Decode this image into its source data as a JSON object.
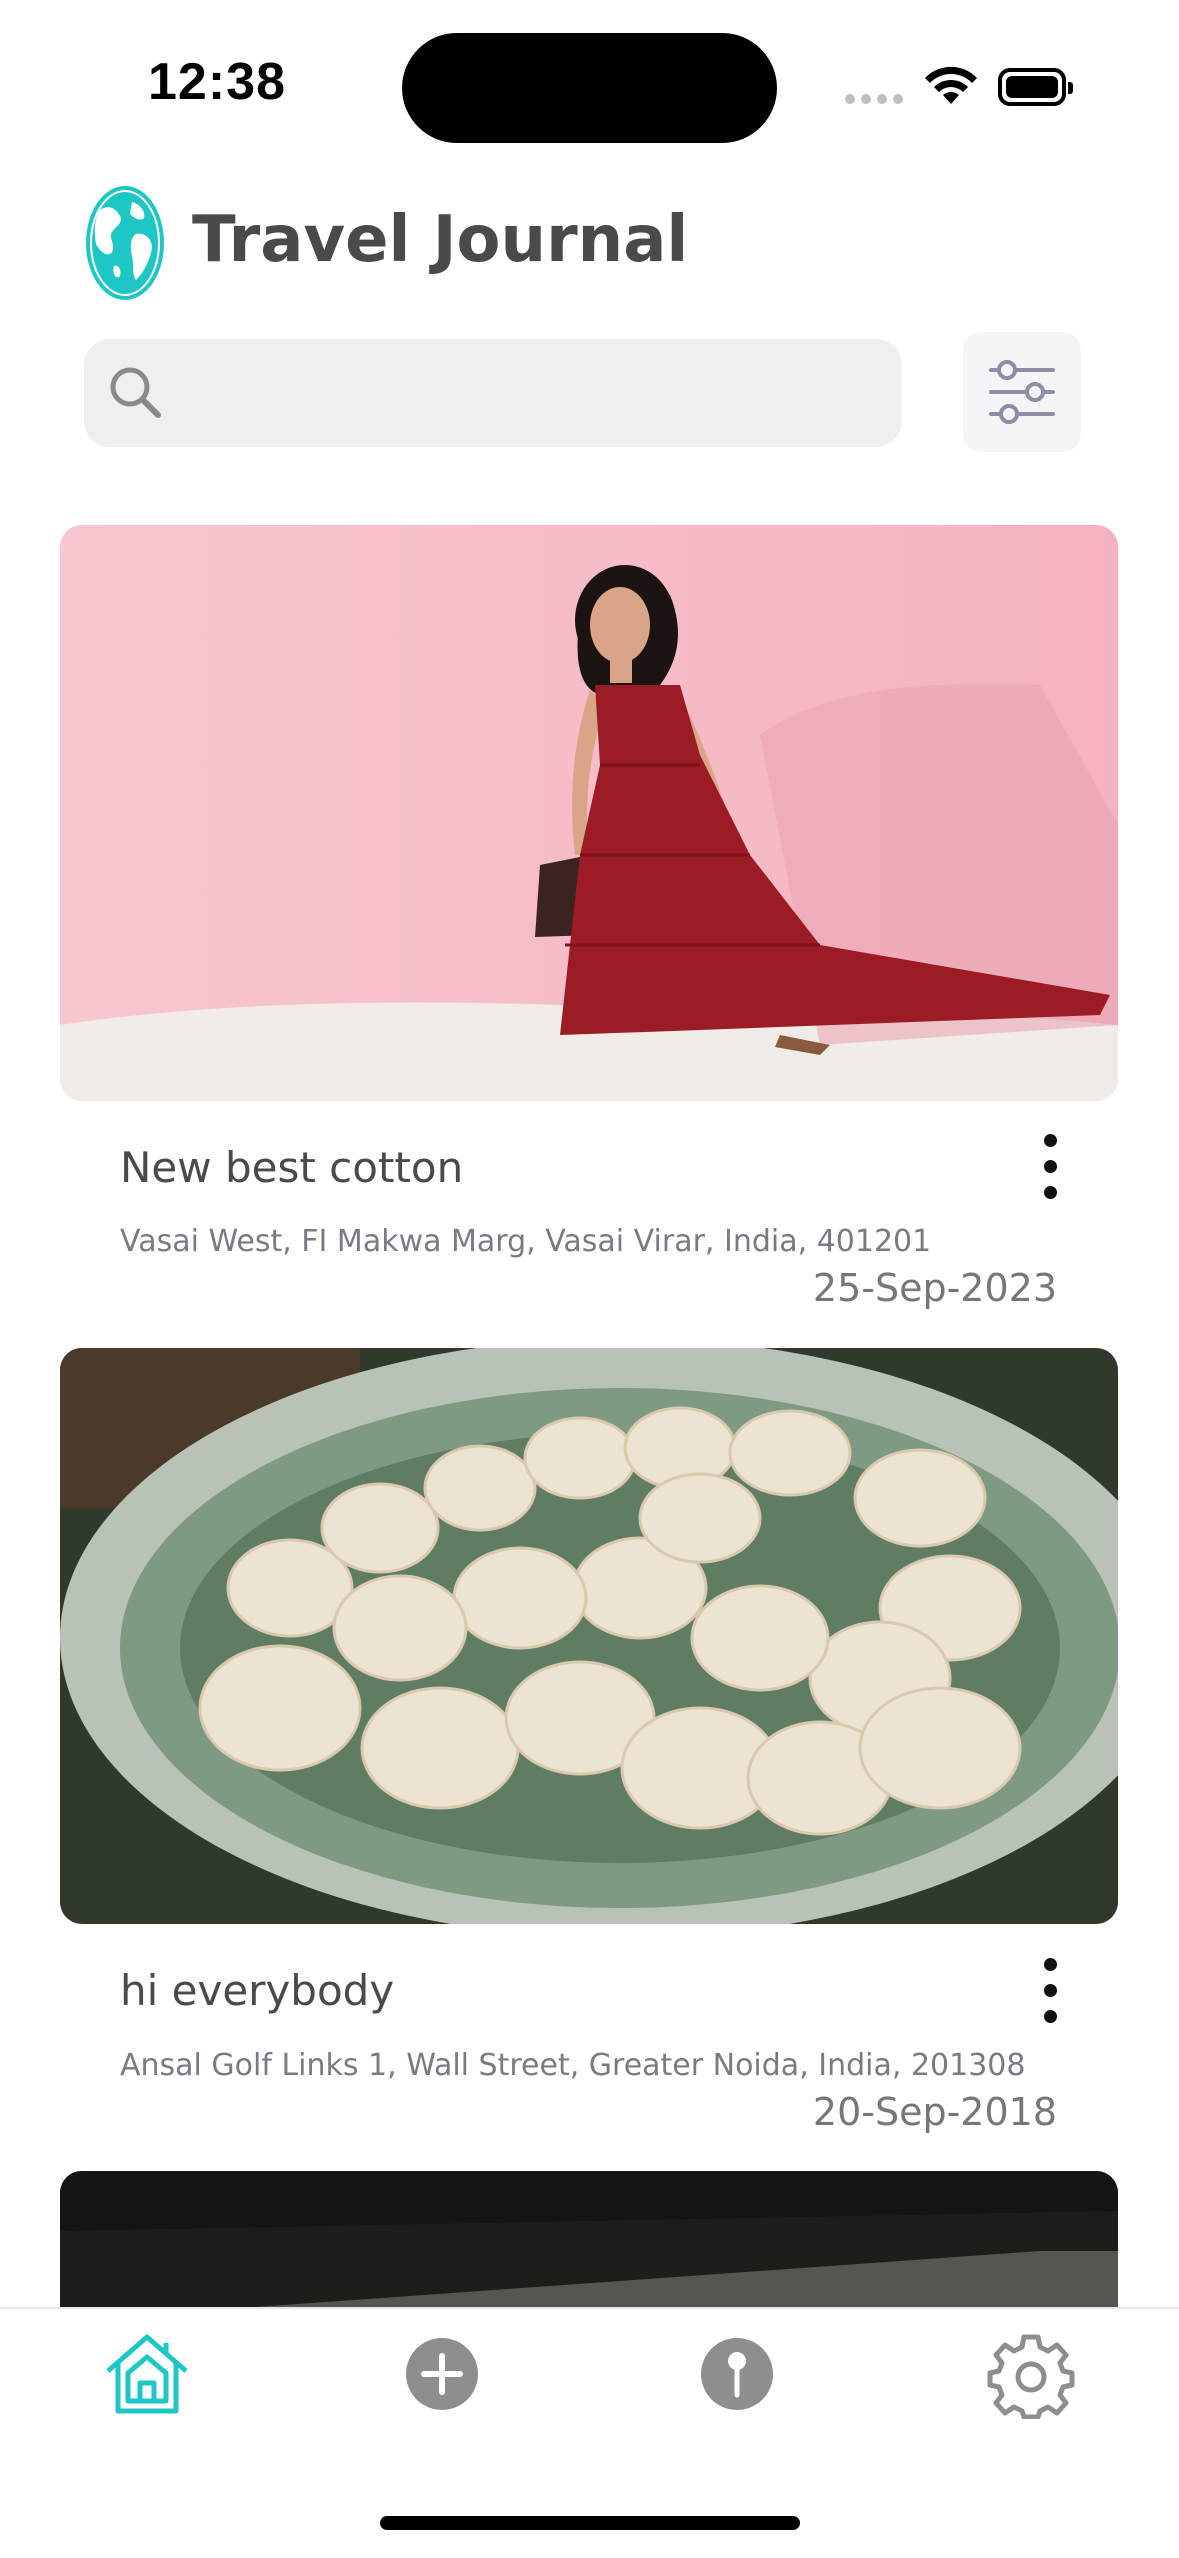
{
  "status_bar": {
    "time": "12:38"
  },
  "header": {
    "title": "Travel Journal"
  },
  "search": {
    "placeholder": "",
    "value": ""
  },
  "entries": [
    {
      "title": "New best cotton",
      "address": "Vasai West, FI Makwa Marg, Vasai Virar, India, 401201",
      "date": "25-Sep-2023",
      "image": "woman-in-red-dress-photo"
    },
    {
      "title": "hi everybody",
      "address": "Ansal Golf Links 1, Wall Street, Greater Noida, India, 201308",
      "date": "20-Sep-2018",
      "image": "modak-dumplings-plate-photo"
    },
    {
      "title": "",
      "address": "",
      "date": "",
      "image": "dark-room-photo"
    }
  ],
  "tabbar": {
    "items": [
      {
        "icon": "home-icon",
        "active": true
      },
      {
        "icon": "add-icon",
        "active": false
      },
      {
        "icon": "map-pin-icon",
        "active": false
      },
      {
        "icon": "settings-icon",
        "active": false
      }
    ]
  },
  "colors": {
    "accent": "#1fc7c4",
    "inactive_icon": "#8e8e8e",
    "text": "#4a4a4a",
    "address_text": "#7a7a85"
  }
}
